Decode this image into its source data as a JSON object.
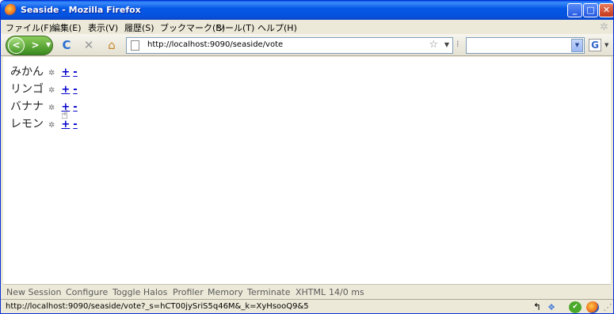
{
  "window": {
    "title": "Seaside - Mozilla Firefox",
    "minimize": "_",
    "maximize": "□",
    "close": "✕"
  },
  "menu": [
    "ファイル(F)",
    "編集(E)",
    "表示(V)",
    "履歴(S)",
    "ブックマーク(B)",
    "ツール(T)",
    "ヘルプ(H)"
  ],
  "nav": {
    "back": "<",
    "forward": ">",
    "reload": "C",
    "stop": "✕",
    "home": "⌂",
    "url": "http://localhost:9090/seaside/vote",
    "search_value": ""
  },
  "items": [
    {
      "name": "みかん",
      "mark": "✲",
      "plus": "+",
      "minus": "-"
    },
    {
      "name": "リンゴ",
      "mark": "✲",
      "plus": "+",
      "minus": "-"
    },
    {
      "name": "バナナ",
      "mark": "✲",
      "plus": "+",
      "minus": "-"
    },
    {
      "name": "レモン",
      "mark": "✲",
      "plus": "+",
      "minus": "-"
    }
  ],
  "halos": [
    "New Session",
    "Configure",
    "Toggle Halos",
    "Profiler",
    "Memory",
    "Terminate",
    "XHTML",
    "14/0 ms"
  ],
  "status": {
    "text": "http://localhost:9090/seaside/vote?_s=hCT00jySriS5q46M&_k=XyHsooQ9&5"
  },
  "colors": {
    "title_bar": "#0558e6",
    "link": "#0000cc",
    "chrome": "#ece9d8"
  },
  "icons": [
    "firefox-icon",
    "back-arrow-icon",
    "forward-arrow-icon",
    "reload-icon",
    "stop-icon",
    "home-icon",
    "page-icon",
    "bookmark-star-icon",
    "search-engine-icon",
    "google-icon",
    "hand-cursor-icon",
    "status-icons"
  ]
}
